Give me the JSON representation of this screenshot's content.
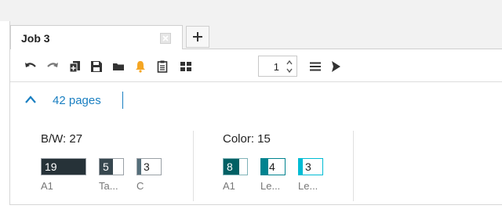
{
  "tab": {
    "title": "Job 3",
    "add_label": "+"
  },
  "toolbar": {
    "icons": [
      "undo-icon",
      "redo-icon",
      "insert-pages-icon",
      "save-icon",
      "folder-icon",
      "bell-icon",
      "clipboard-icon",
      "layout-grid-icon",
      "copies-stepper",
      "menu-icon",
      "send-icon"
    ],
    "copies": "1",
    "accent": "#f5a623"
  },
  "summary": {
    "pages_label": "42 pages",
    "link_color": "#1a7fc1"
  },
  "bw": {
    "title": "B/W: 27",
    "items": [
      {
        "count": "19",
        "caption": "A1",
        "fill": 1.0,
        "color": "#263238"
      },
      {
        "count": "5",
        "caption": "Ta...",
        "fill": 0.55,
        "color": "#37474f"
      },
      {
        "count": "3",
        "caption": "C",
        "fill": 0.18,
        "color": "#546e7a"
      }
    ]
  },
  "color": {
    "title": "Color: 15",
    "items": [
      {
        "count": "8",
        "caption": "A1",
        "fill": 0.65,
        "color": "#006064"
      },
      {
        "count": "4",
        "caption": "Le...",
        "fill": 0.3,
        "color": "#00838f"
      },
      {
        "count": "3",
        "caption": "Le...",
        "fill": 0.18,
        "color": "#00bcd4"
      }
    ]
  }
}
